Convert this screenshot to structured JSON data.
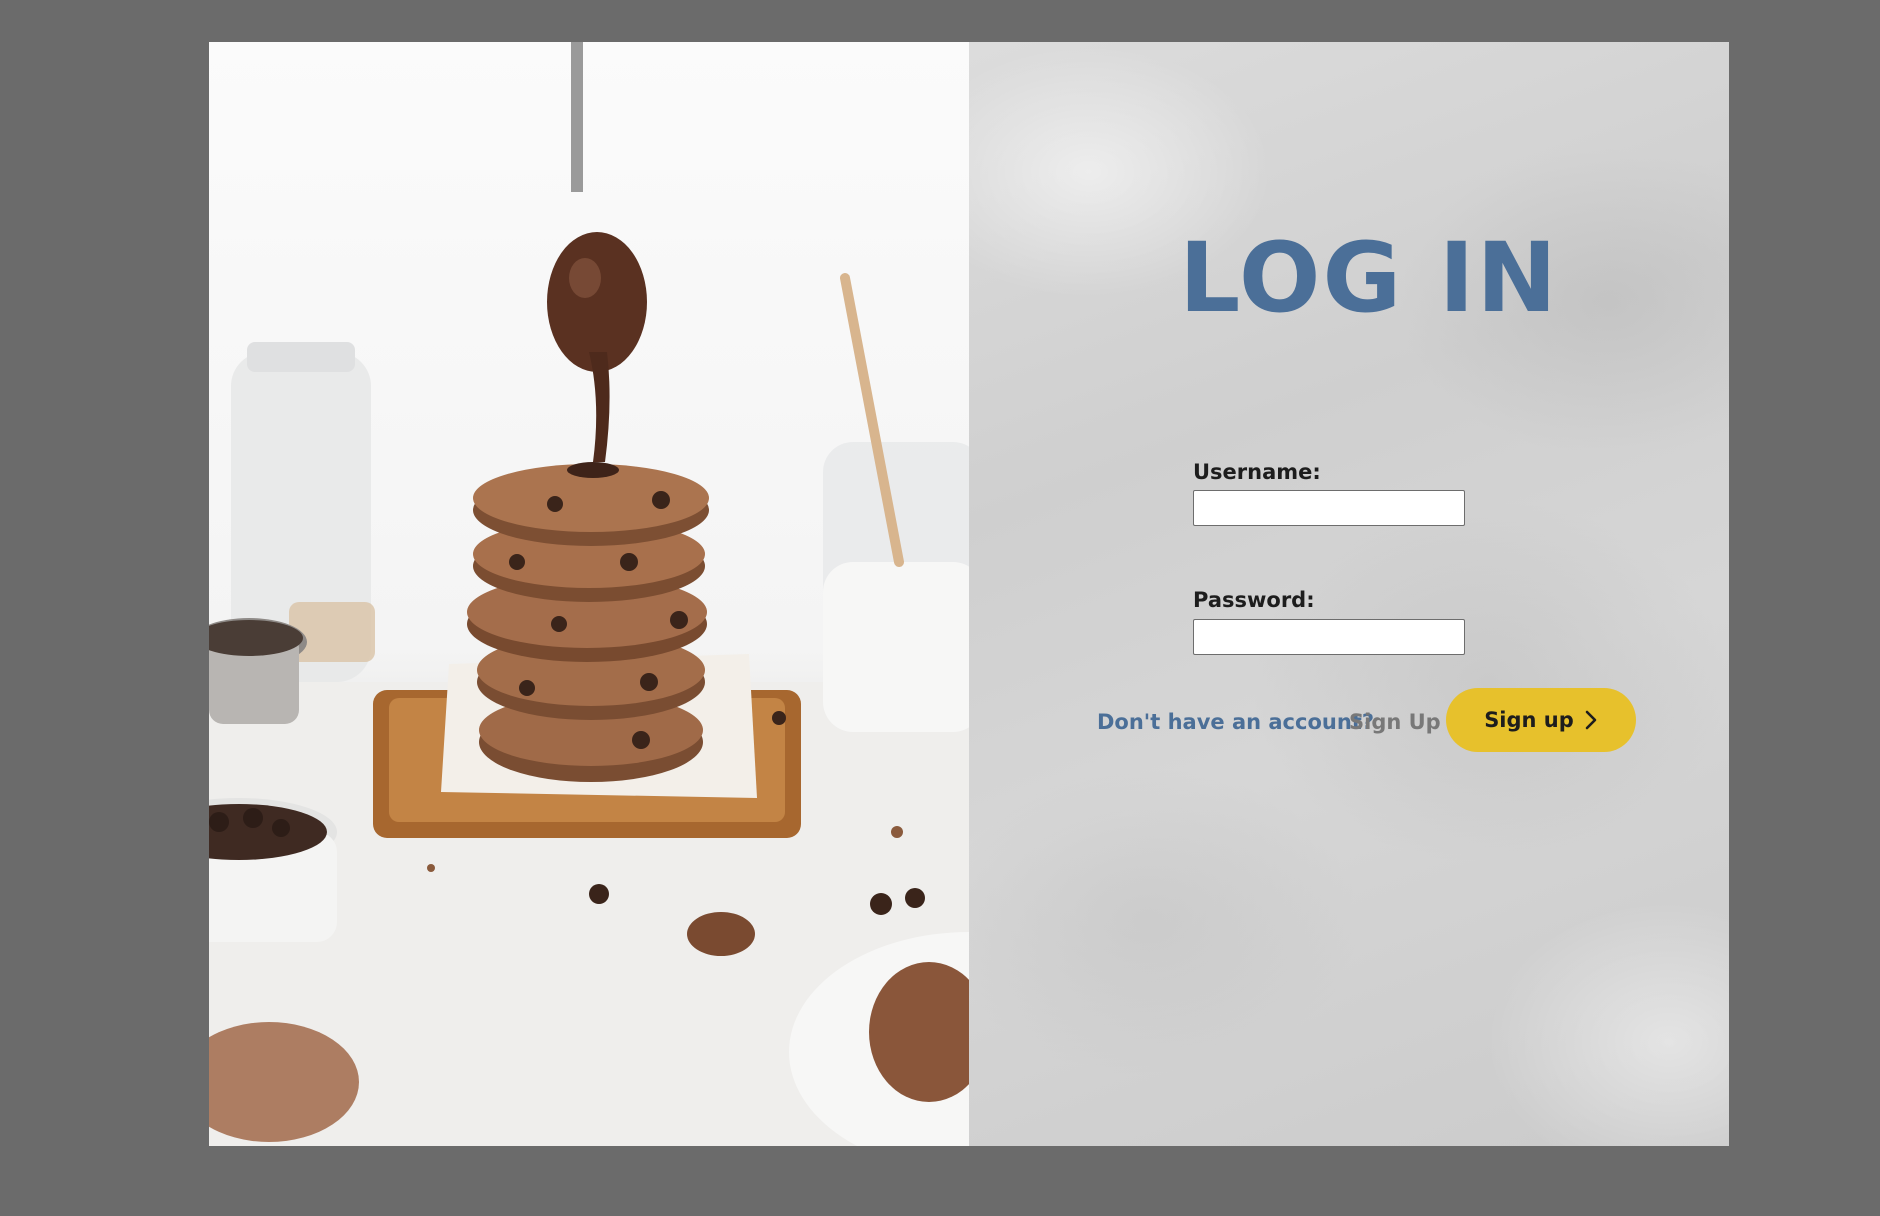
{
  "photo": {
    "alt_name": "chocolate-chip-cookie-stack-photo"
  },
  "login": {
    "title": "LOG IN",
    "username": {
      "label": "Username:",
      "value": "",
      "placeholder": ""
    },
    "password": {
      "label": "Password:",
      "value": "",
      "placeholder": ""
    },
    "signup_prompt": "Don't have an account?",
    "signup_link": "Sign Up",
    "signup_button": "Sign up",
    "signup_button_icon": "chevron-right-icon"
  },
  "colors": {
    "page_background": "#6b6b6b",
    "title_blue": "#4b6f98",
    "button_yellow": "#e7c12c",
    "link_gray": "#787878"
  }
}
